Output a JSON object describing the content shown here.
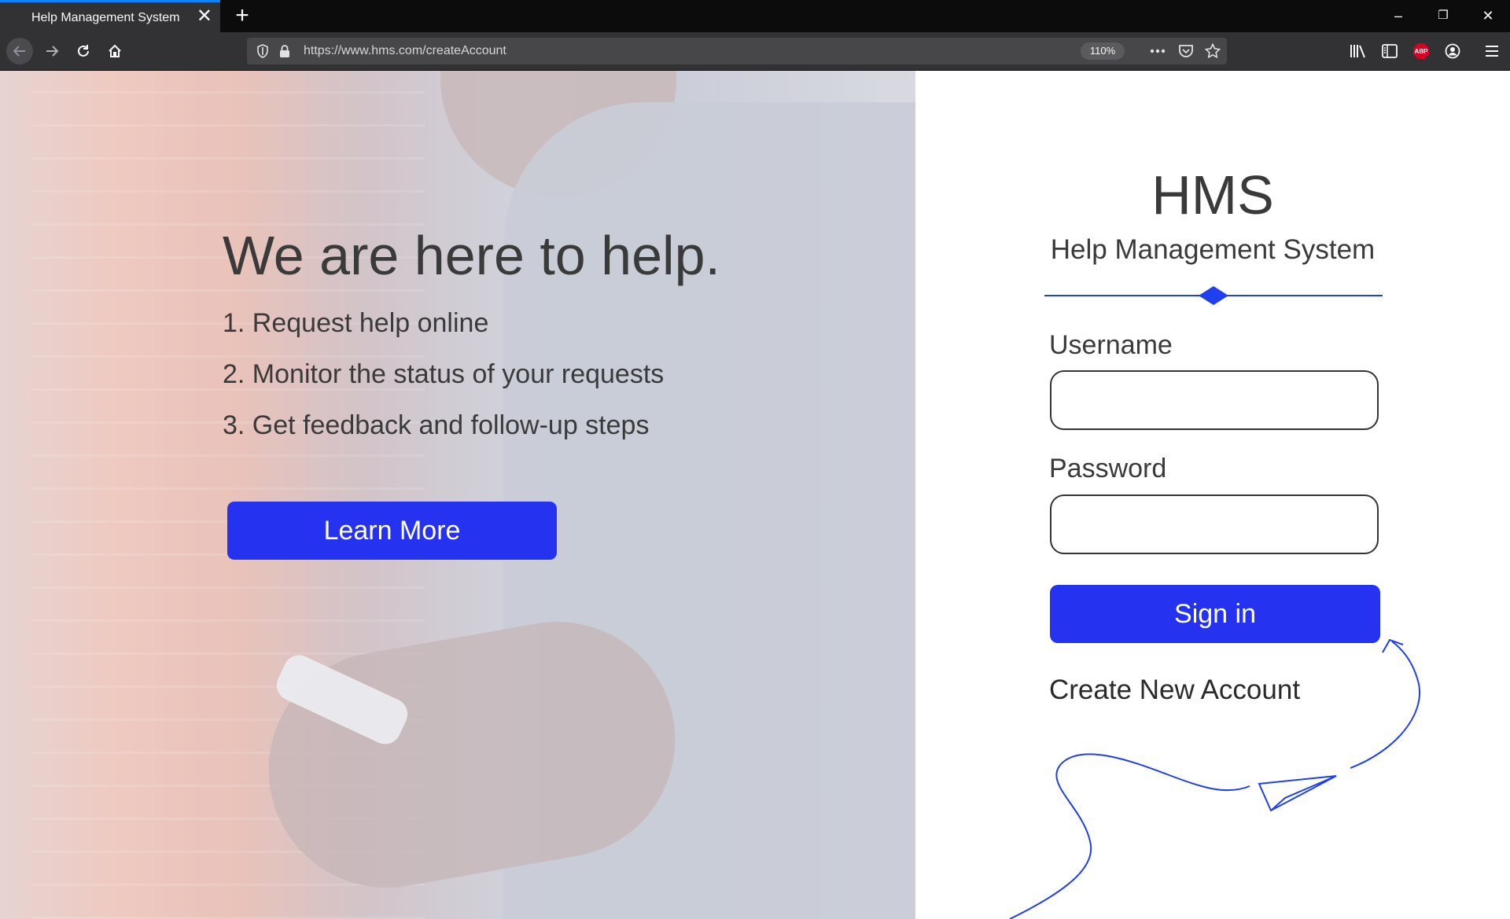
{
  "browser": {
    "tab_title": "Help Management System",
    "url": "https://www.hms.com/createAccount",
    "zoom": "110%",
    "adblock_badge": "ABP"
  },
  "hero": {
    "headline": "We are here to help.",
    "steps": [
      "1. Request help online",
      "2. Monitor the status of your requests",
      "3. Get feedback and follow-up steps"
    ],
    "learn_more_label": "Learn More"
  },
  "login": {
    "logo": "HMS",
    "subtitle": "Help Management System",
    "username_label": "Username",
    "username_value": "",
    "password_label": "Password",
    "password_value": "",
    "signin_label": "Sign in",
    "create_account_label": "Create New Account"
  },
  "colors": {
    "accent": "#2532f0",
    "divider": "#1f3ff0",
    "text": "#3a3a3a",
    "chrome_dark": "#0c0c0d",
    "chrome_toolbar": "#323234"
  },
  "icons": {
    "tab_close": "close-icon",
    "new_tab": "plus-icon",
    "back": "arrow-left-icon",
    "forward": "arrow-right-icon",
    "reload": "reload-icon",
    "home": "home-icon",
    "tracking": "shield-icon",
    "lock": "lock-icon",
    "more": "ellipsis-icon",
    "pocket": "pocket-icon",
    "bookmark": "star-icon",
    "library": "library-icon",
    "sidebar": "sidebar-icon",
    "account": "account-icon",
    "menu": "hamburger-icon",
    "decoration": "paper-plane-icon"
  }
}
